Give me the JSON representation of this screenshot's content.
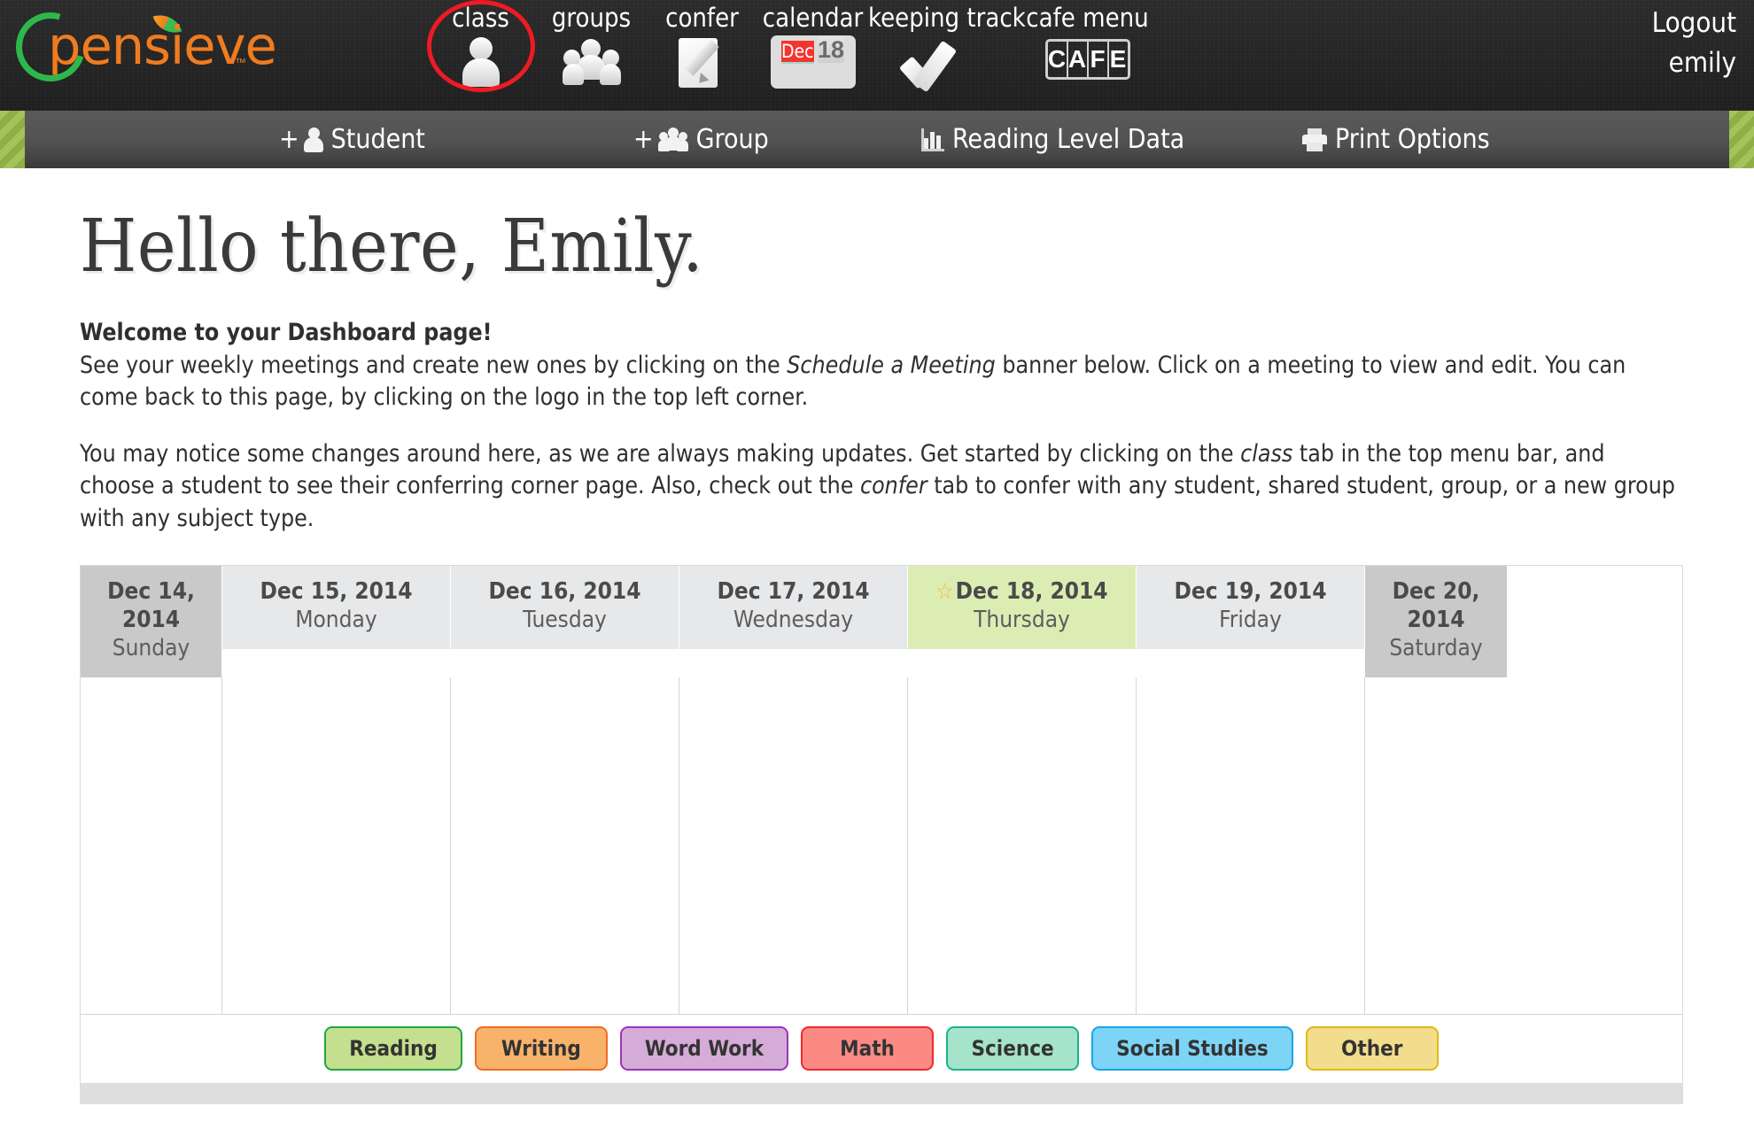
{
  "brand": {
    "name": "pensieve",
    "trademark": "™"
  },
  "nav": [
    {
      "label": "class",
      "icon": "person-icon",
      "selected": true
    },
    {
      "label": "groups",
      "icon": "group-icon",
      "selected": false
    },
    {
      "label": "confer",
      "icon": "note-pencil-icon",
      "selected": false
    },
    {
      "label": "calendar",
      "icon": "calendar-icon",
      "selected": false,
      "month": "Dec",
      "day": "18"
    },
    {
      "label": "keeping track",
      "icon": "checkmark-icon",
      "selected": false
    },
    {
      "label": "cafe menu",
      "icon": "cafe-icon",
      "selected": false,
      "letters": [
        "C",
        "A",
        "F",
        "E"
      ]
    }
  ],
  "account": {
    "logout": "Logout",
    "username": "emily"
  },
  "toolbar": {
    "add_student": "Student",
    "add_group": "Group",
    "plus": "+",
    "reading_level_data": "Reading Level Data",
    "print_options": "Print Options"
  },
  "page": {
    "greeting": "Hello there, Emily.",
    "welcome_heading": "Welcome to your Dashboard page!",
    "p1_a": "See your weekly meetings and create new ones by clicking on the ",
    "p1_em": "Schedule a Meeting",
    "p1_b": " banner below. Click on a meeting to view and edit. You can come back to this page, by clicking on the logo in the top left corner.",
    "p2_a": "You may notice some changes around here, as we are always making updates. Get started by clicking on the ",
    "p2_em1": "class",
    "p2_b": " tab in the top menu bar, and choose a student to see their conferring corner page. Also, check out the ",
    "p2_em2": "confer",
    "p2_c": " tab to confer with any student, shared student, group, or a new group with any subject type."
  },
  "calendar": {
    "star": "☆",
    "days": [
      {
        "date": "Dec 14, 2014",
        "day": "Sunday",
        "type": "weekend"
      },
      {
        "date": "Dec 15, 2014",
        "day": "Monday",
        "type": "weekday"
      },
      {
        "date": "Dec 16, 2014",
        "day": "Tuesday",
        "type": "weekday"
      },
      {
        "date": "Dec 17, 2014",
        "day": "Wednesday",
        "type": "weekday"
      },
      {
        "date": "Dec 18, 2014",
        "day": "Thursday",
        "type": "today"
      },
      {
        "date": "Dec 19, 2014",
        "day": "Friday",
        "type": "weekday"
      },
      {
        "date": "Dec 20, 2014",
        "day": "Saturday",
        "type": "weekend"
      }
    ]
  },
  "legend": [
    {
      "label": "Reading",
      "fill": "#c4df8d",
      "border": "#21a73e"
    },
    {
      "label": "Writing",
      "fill": "#f8b26a",
      "border": "#ee6c24"
    },
    {
      "label": "Word Work",
      "fill": "#d5abd8",
      "border": "#9b34b8"
    },
    {
      "label": "Math",
      "fill": "#fb8a85",
      "border": "#ef2b2b"
    },
    {
      "label": "Science",
      "fill": "#a5e3cb",
      "border": "#17b58a"
    },
    {
      "label": "Social Studies",
      "fill": "#7ed4f7",
      "border": "#16a6e8"
    },
    {
      "label": "Other",
      "fill": "#f2dd8d",
      "border": "#e3b816"
    }
  ],
  "colors": {
    "header_bg": "#252525",
    "subbar_bg": "#525252",
    "today_bg": "#dcedb4",
    "weekend_bg": "#c9c9c9",
    "weekday_bg": "#e7e8ea",
    "accent_red": "#ee1b24",
    "brand_orange": "#f07c1f",
    "brand_green": "#2eb84c"
  }
}
